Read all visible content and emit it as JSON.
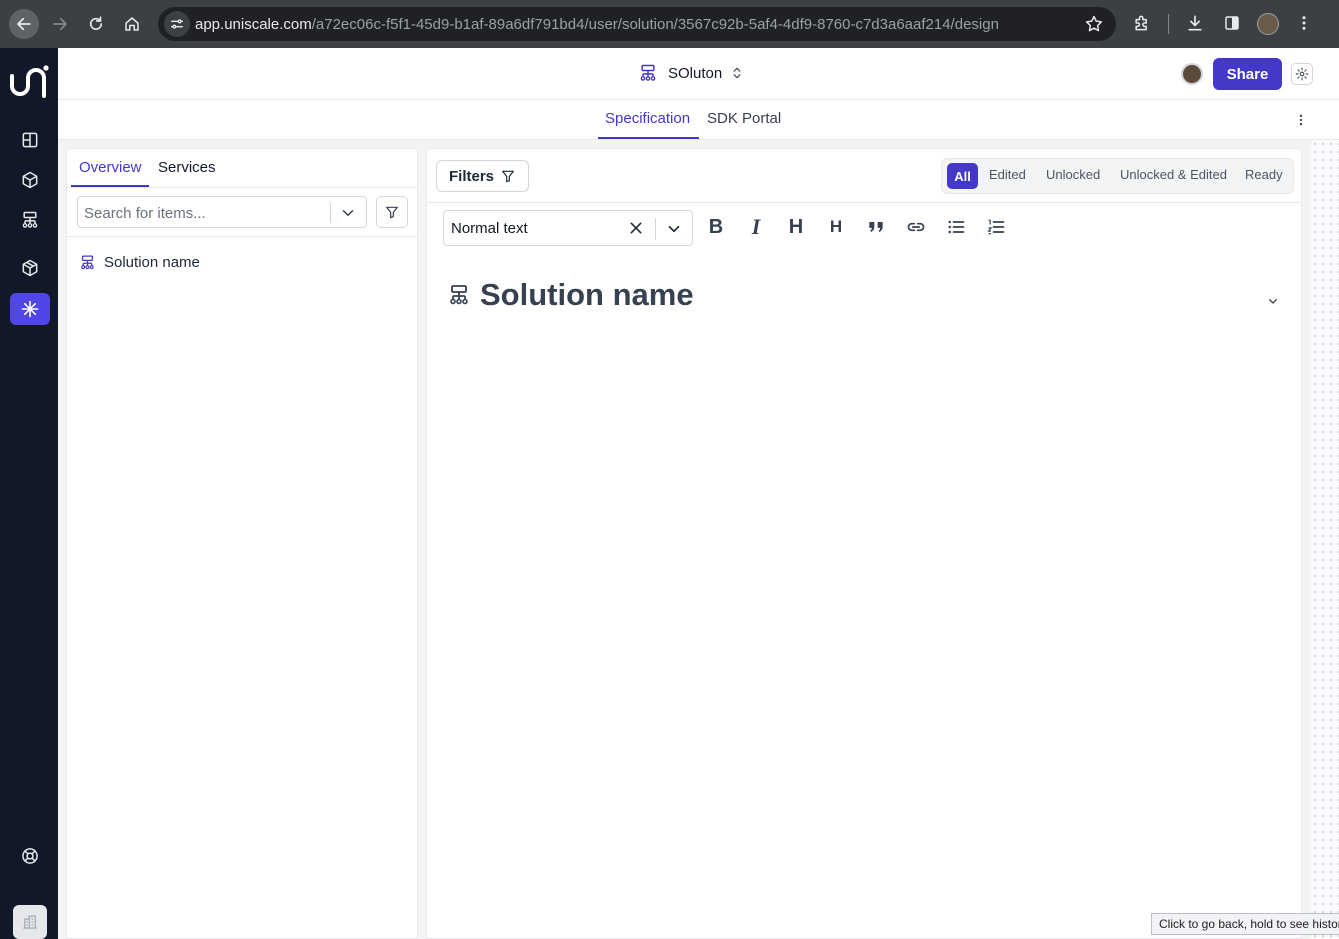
{
  "browser": {
    "url_host": "app.uniscale.com",
    "url_path": "/a72ec06c-f5f1-45d9-b1af-89a6df791bd4/user/solution/3567c92b-5af4-4df9-8760-c7d3a6aaf214/design",
    "tooltip": "Click to go back, hold to see history"
  },
  "rail": {
    "items": [
      {
        "icon": "layout-grid-icon"
      },
      {
        "icon": "cube-icon"
      },
      {
        "icon": "hierarchy-icon"
      },
      {
        "icon": "package-icon"
      },
      {
        "icon": "asterisk-icon",
        "active": true
      }
    ],
    "bottom": [
      {
        "icon": "help-lifebuoy-icon"
      },
      {
        "icon": "building-icon"
      }
    ]
  },
  "header": {
    "solution_name": "SOluton",
    "share_label": "Share"
  },
  "subtabs": [
    "Specification",
    "SDK Portal"
  ],
  "left_panel": {
    "tabs": [
      "Overview",
      "Services"
    ],
    "search_placeholder": "Search for items...",
    "tree": [
      {
        "label": "Solution name"
      }
    ]
  },
  "right_panel": {
    "filters_label": "Filters",
    "segments": [
      "All",
      "Edited",
      "Unlocked",
      "Unlocked & Edited",
      "Ready"
    ],
    "text_style": "Normal text",
    "toolbar": {
      "bold": "B",
      "italic": "I",
      "h1": "H",
      "h2": "H"
    },
    "doc_title": "Solution name"
  },
  "colors": {
    "accent": "#4338ca",
    "rail": "#111827"
  }
}
